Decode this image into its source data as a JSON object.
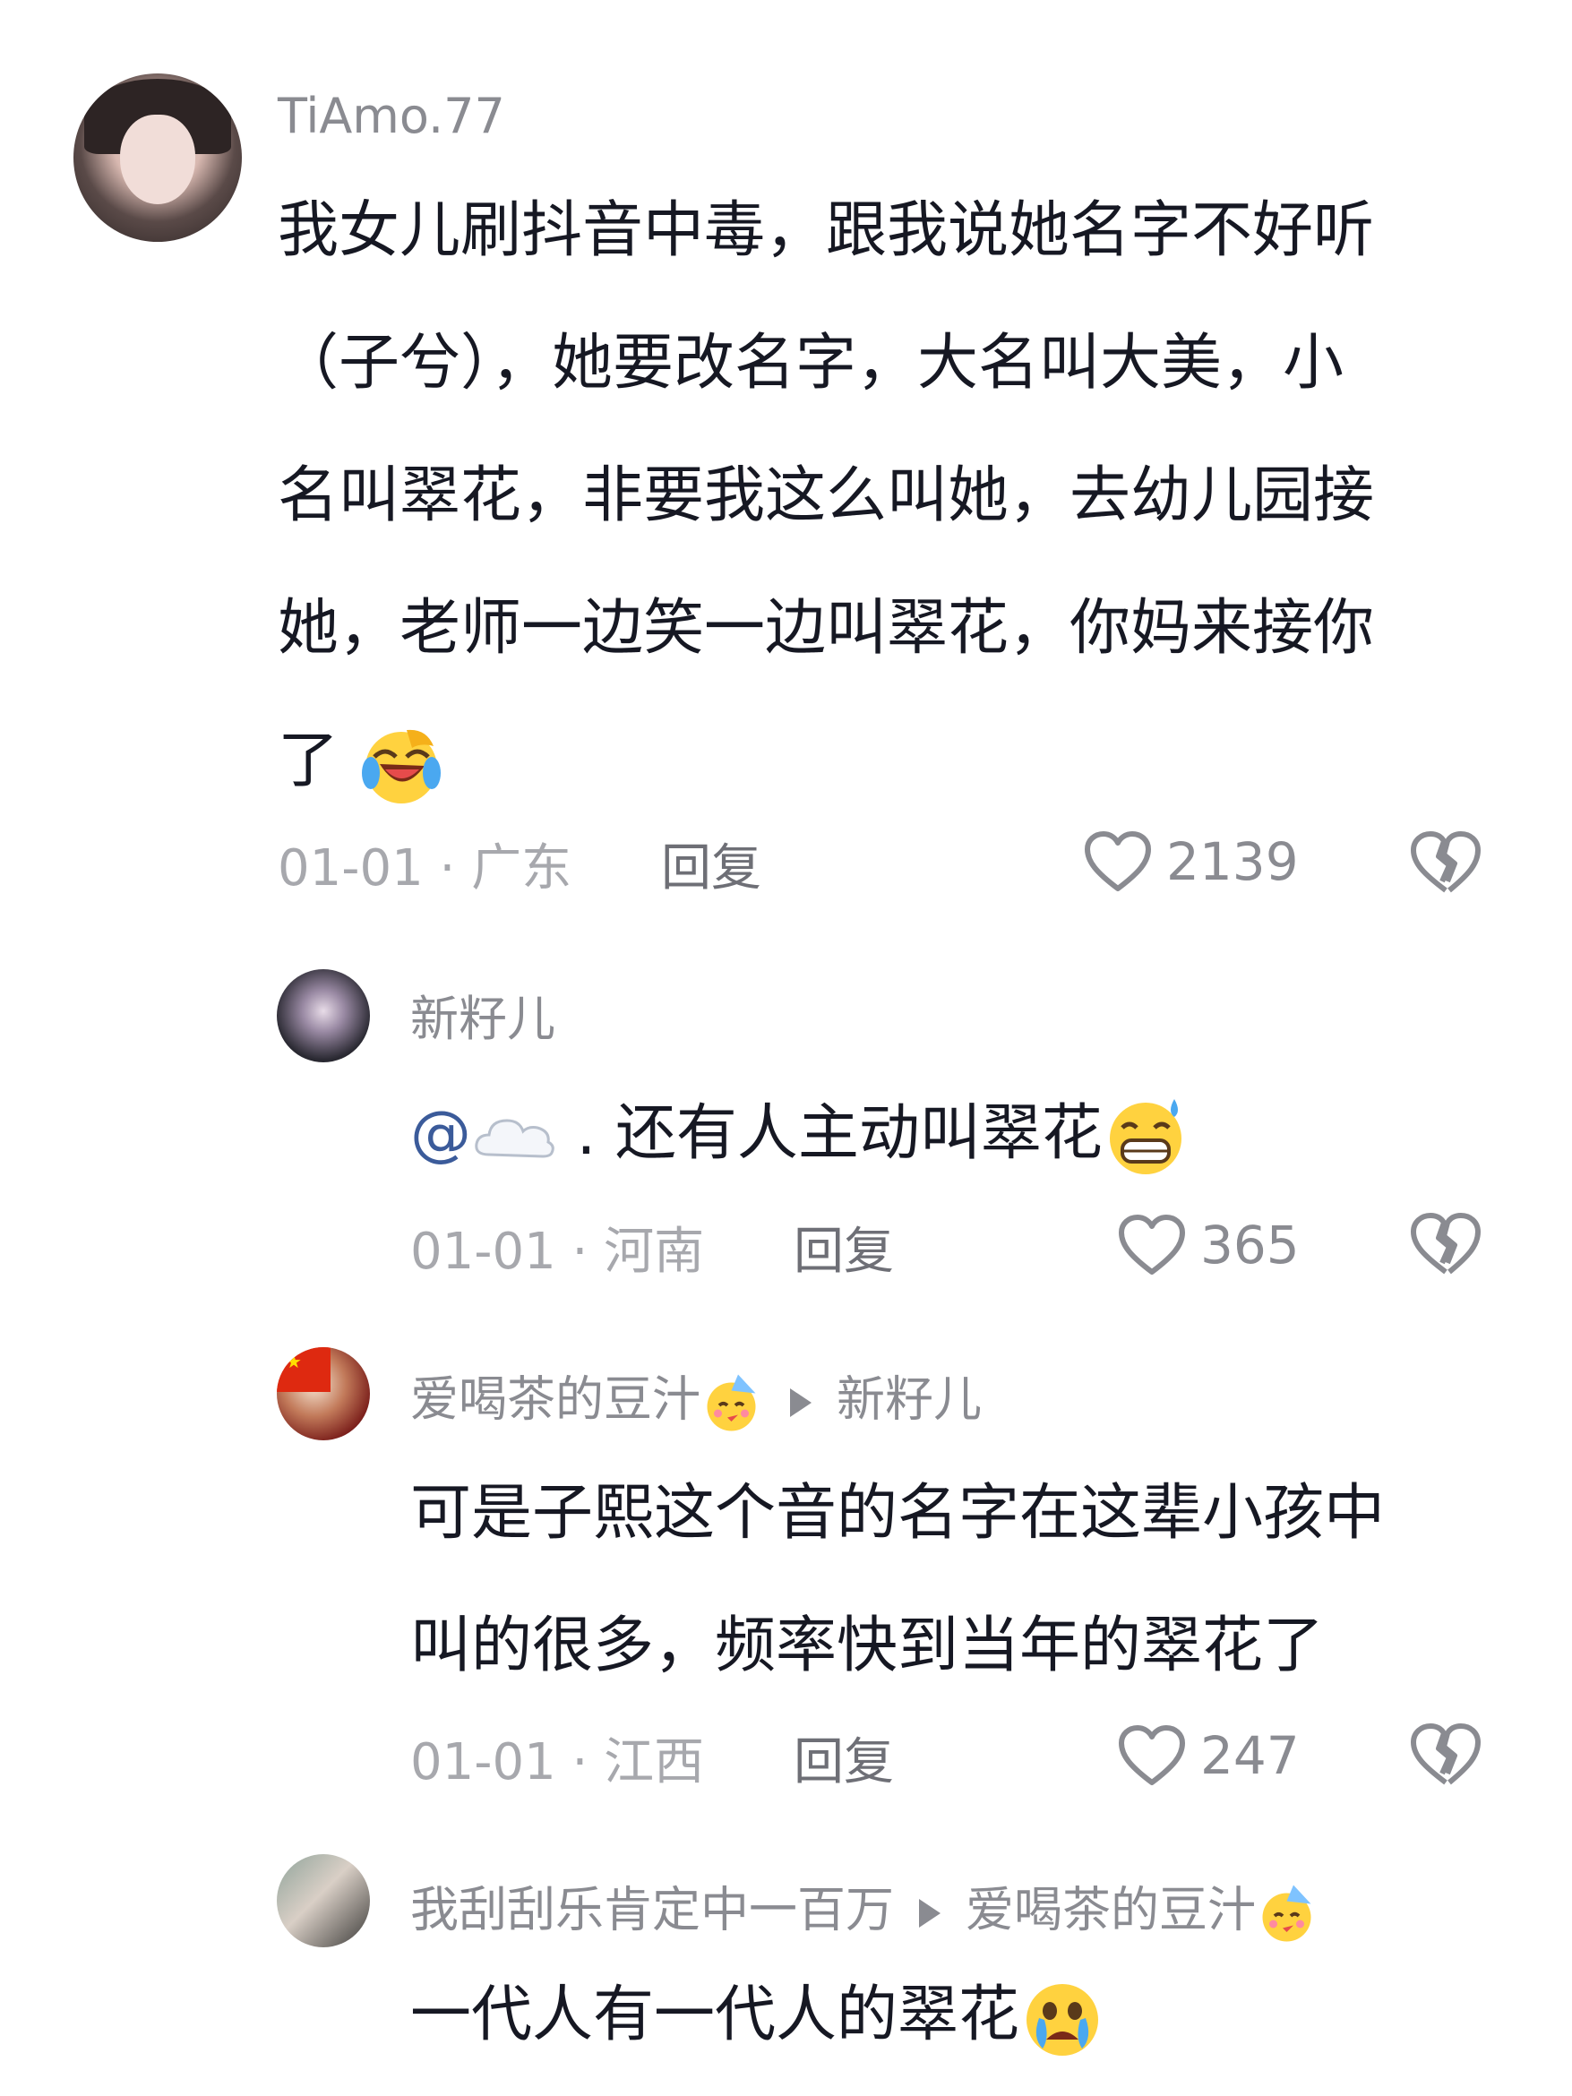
{
  "comments": [
    {
      "username": "TiAmo.77",
      "lines": [
        "我女儿刷抖音中毒，跟我说她名字不好听",
        "（子兮），她要改名字，大名叫大美，小",
        "名叫翠花，非要我这么叫她，去幼儿园接",
        "她，老师一边笑一边叫翠花，你妈来接你",
        "了"
      ],
      "date": "01-01",
      "location": "广东",
      "reply_label": "回复",
      "likes": "2139"
    },
    {
      "username": "新籽儿",
      "mention": "@",
      "text": ". 还有人主动叫翠花",
      "date": "01-01",
      "location": "河南",
      "reply_label": "回复",
      "likes": "365"
    },
    {
      "username": "爱喝茶的豆汁",
      "reply_to": "新籽儿",
      "lines": [
        "可是子熙这个音的名字在这辈小孩中",
        "叫的很多，频率快到当年的翠花了"
      ],
      "date": "01-01",
      "location": "江西",
      "reply_label": "回复",
      "likes": "247"
    },
    {
      "username": "我刮刮乐肯定中一百万",
      "reply_to": "爱喝茶的豆汁",
      "text": "一代人有一代人的翠花"
    }
  ],
  "separator": "·",
  "icons": {
    "like": "heart-outline-icon",
    "dislike": "broken-heart-icon",
    "emoji_laugh": "rofl-emoji-icon",
    "emoji_sweat": "grin-sweat-emoji-icon",
    "emoji_party": "party-face-emoji-icon",
    "emoji_cry": "crying-face-emoji-icon",
    "cloud": "cloud-emoji-icon"
  },
  "colors": {
    "text": "#161823",
    "username": "#8a8b91",
    "meta": "#a7a8ad",
    "mention": "#3b5b9a"
  }
}
